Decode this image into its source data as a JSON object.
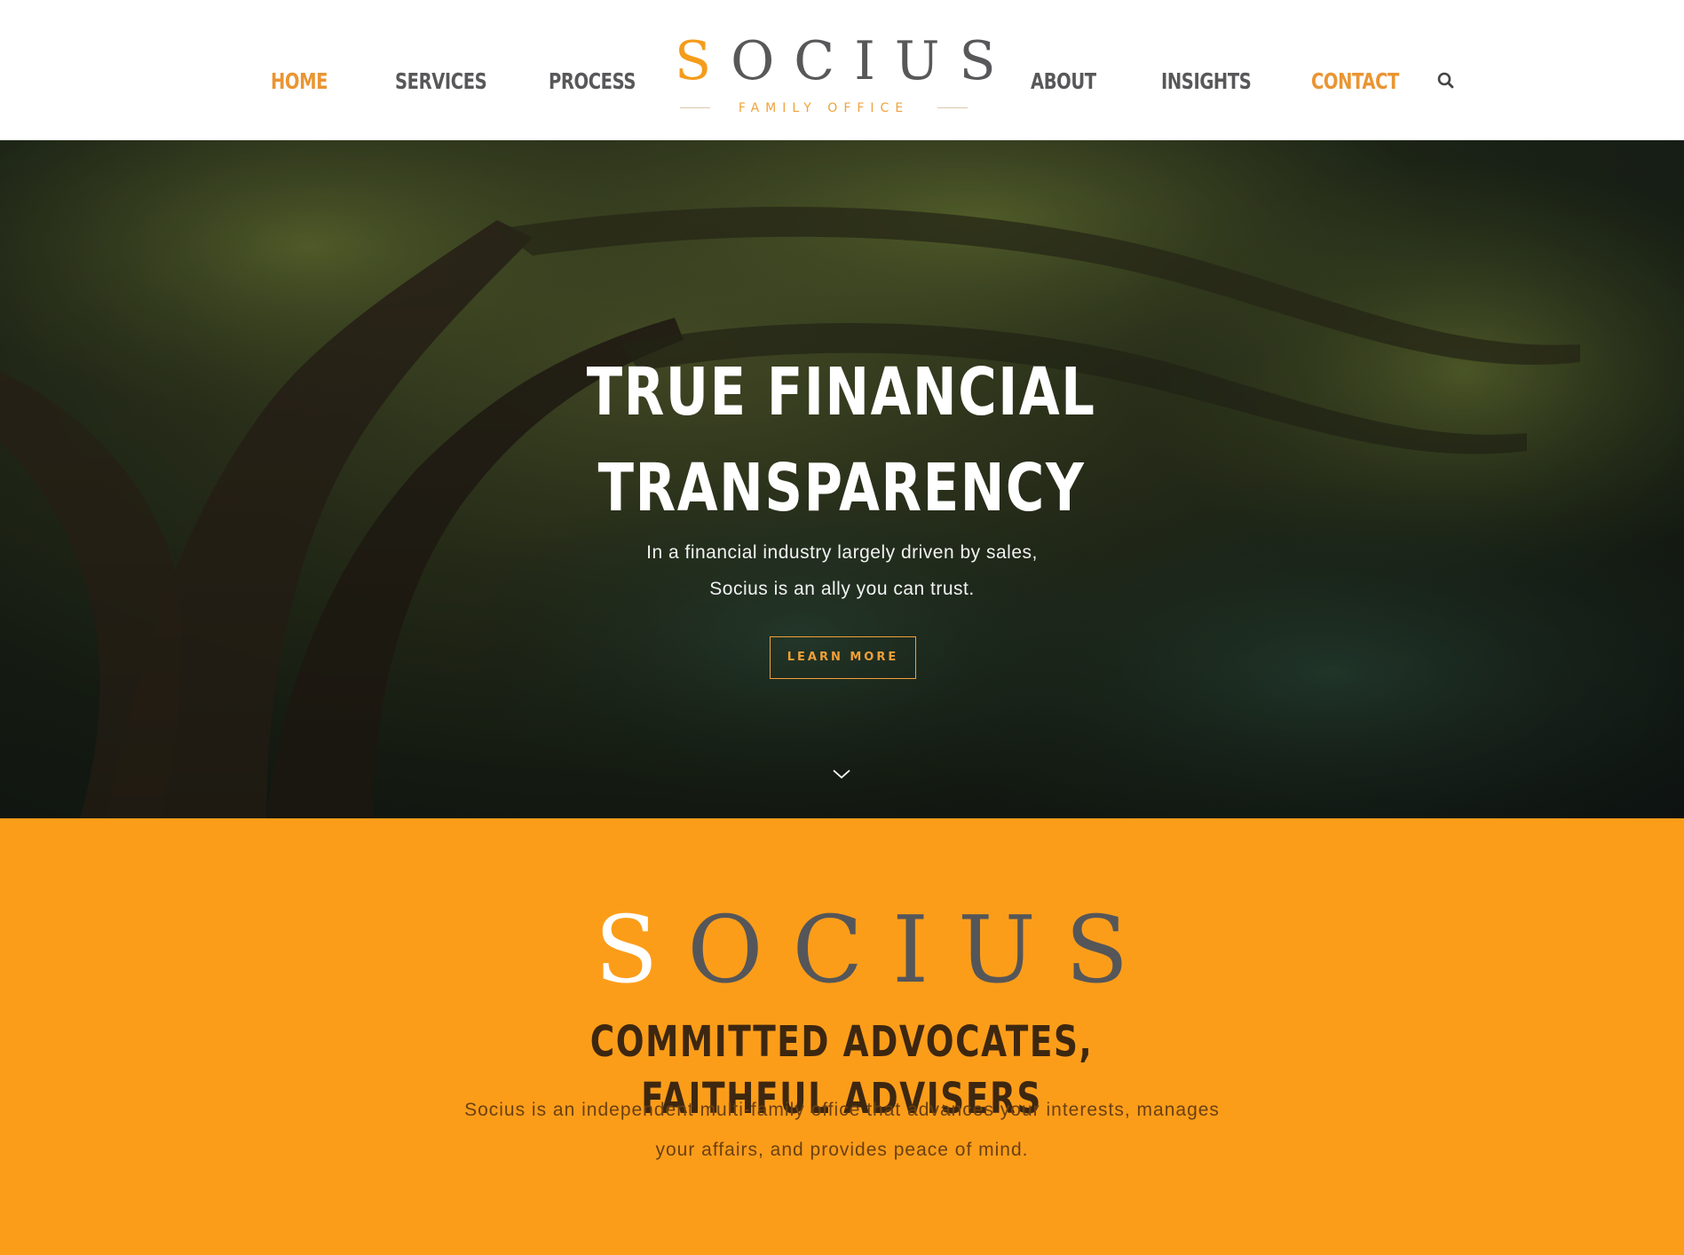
{
  "nav": {
    "items": [
      {
        "label": "HOME",
        "active": true
      },
      {
        "label": "SERVICES",
        "active": false
      },
      {
        "label": "PROCESS",
        "active": false
      },
      {
        "label": "ABOUT",
        "active": false
      },
      {
        "label": "INSIGHTS",
        "active": false
      },
      {
        "label": "CONTACT",
        "active": true
      }
    ],
    "search_icon": "search-icon"
  },
  "logo": {
    "first_letter": "S",
    "rest": "OCIUS",
    "tagline": "FAMILY OFFICE"
  },
  "hero": {
    "title_line1": "TRUE FINANCIAL",
    "title_line2": "TRANSPARENCY",
    "subtitle_line1": "In a financial industry largely driven by sales,",
    "subtitle_line2": "Socius is an ally you can trust.",
    "cta_label": "LEARN MORE",
    "scroll_icon": "chevron-down-icon"
  },
  "about": {
    "logo_first": "S",
    "logo_rest": "OCIUS",
    "heading": "COMMITTED ADVOCATES, FAITHFUL ADVISERS",
    "text_line1": "Socius is an independent multi-family office that advances your interests, manages",
    "text_line2": "your affairs, and provides peace of mind."
  },
  "colors": {
    "accent": "#f59c1a",
    "nav_text": "#58585a",
    "section_bg": "#fc9d1a",
    "heading_dark": "#3d2710"
  }
}
